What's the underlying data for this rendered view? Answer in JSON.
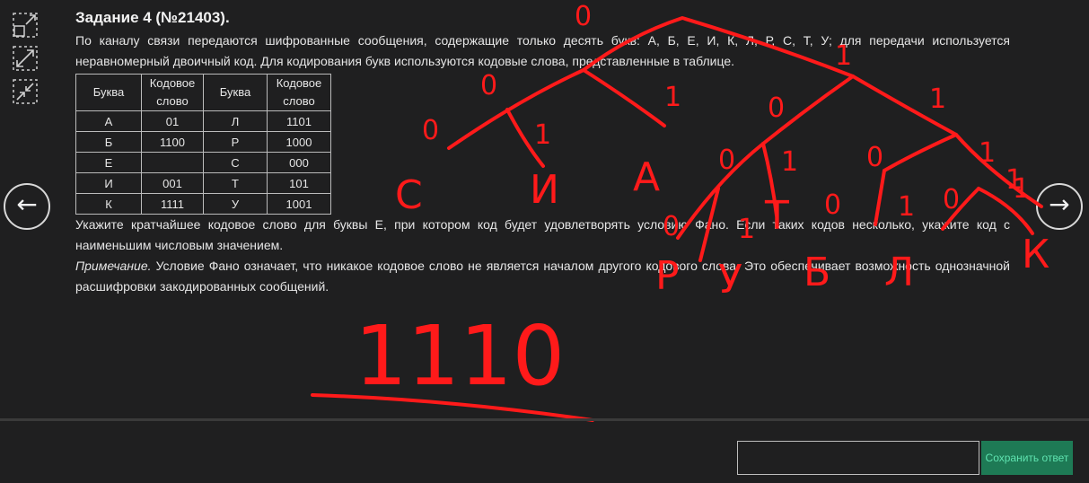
{
  "nav": {
    "prev_glyph": "←",
    "next_glyph": "→"
  },
  "tools": [
    "expand-icon",
    "resize-icon",
    "collapse-icon"
  ],
  "task": {
    "title": "Задание 4 (№21403).",
    "intro": "По каналу связи передаются шифрованные сообщения, содержащие только десять букв: А, Б, Е, И, К, Л, Р, С, Т, У; для передачи используется неравномерный двоичный код. Для кодирования букв используются кодовые слова, представленные в таблице.",
    "table": {
      "headers": [
        "Буква",
        "Кодовое слово",
        "Буква",
        "Кодовое слово"
      ],
      "rows": [
        [
          "А",
          "01",
          "Л",
          "1101"
        ],
        [
          "Б",
          "1100",
          "Р",
          "1000"
        ],
        [
          "Е",
          "",
          "С",
          "000"
        ],
        [
          "И",
          "001",
          "Т",
          "101"
        ],
        [
          "К",
          "1111",
          "У",
          "1001"
        ]
      ]
    },
    "question": "Укажите кратчайшее кодовое слово для буквы Е, при котором код будет удовлетворять условию Фано. Если таких кодов несколько, укажите код с наименьшим числовым значением.",
    "note_label": "Примечание.",
    "note_text": " Условие Фано означает, что никакое кодовое слово не является началом другого кодового слова. Это обеспечивает возможность однозначной расшифровки закодированных сообщений."
  },
  "annotation": {
    "color": "#ff1a1a",
    "tree_labels": [
      "0",
      "1",
      "0",
      "1",
      "0",
      "1",
      "0",
      "1",
      "0",
      "1",
      "0",
      "1",
      "1",
      "0",
      "1",
      "0",
      "1",
      "0",
      "1"
    ],
    "leaf_letters": [
      "С",
      "И",
      "А",
      "Р",
      "У",
      "Т",
      "Б",
      "Л",
      "К"
    ],
    "answer": "1110"
  },
  "answer_box": {
    "value": "",
    "save_label": "Сохранить ответ"
  }
}
